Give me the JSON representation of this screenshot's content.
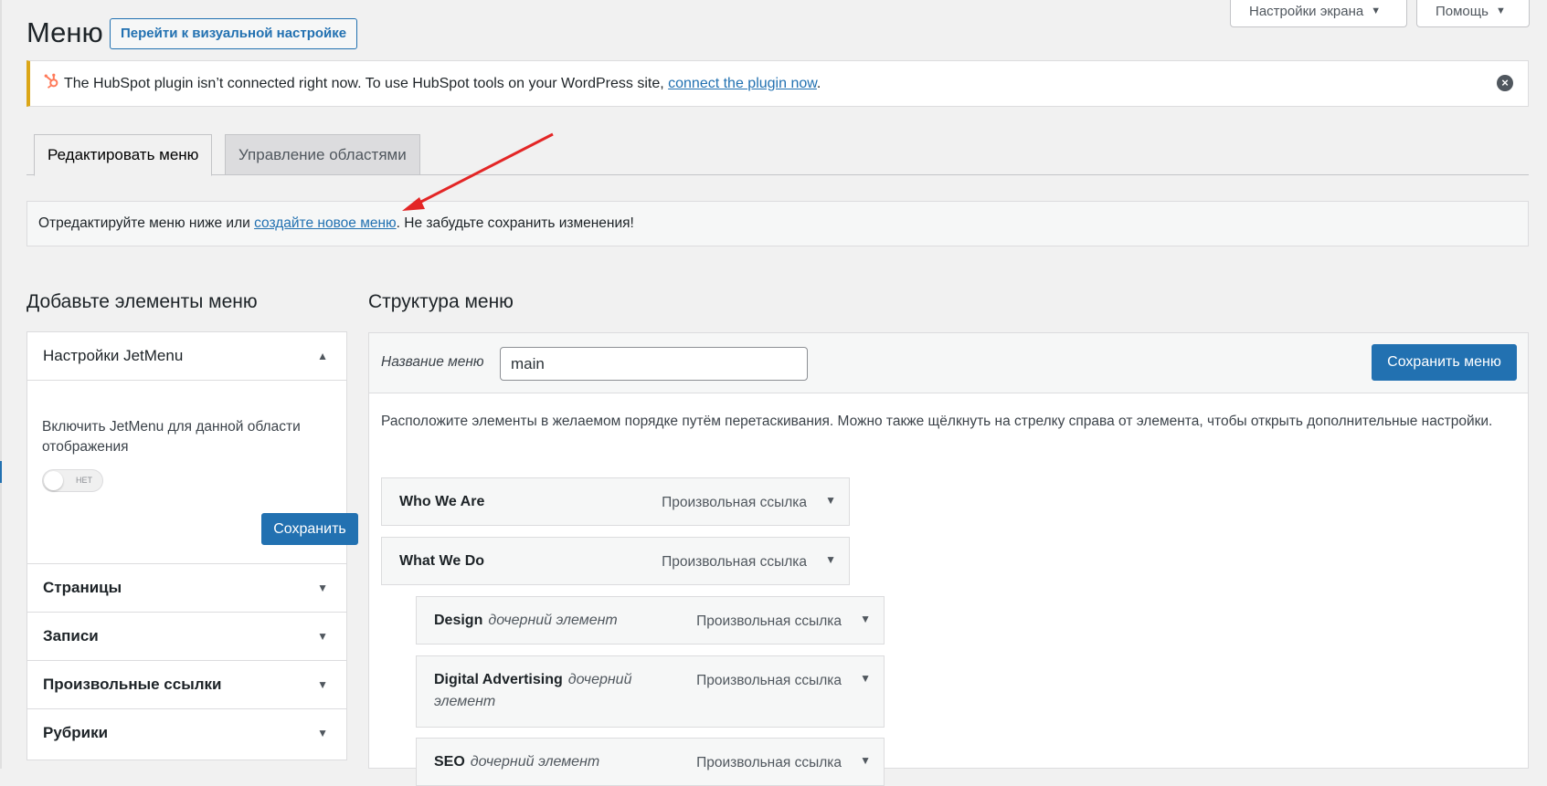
{
  "header": {
    "title": "Меню",
    "visual_settings_button": "Перейти к визуальной настройке",
    "screen_options": "Настройки экрана",
    "help": "Помощь"
  },
  "notice": {
    "text_before": "The HubSpot plugin isn’t connected right now. To use HubSpot tools on your WordPress site, ",
    "link": "connect the plugin now",
    "text_after": ".",
    "accent_color": "#dba617"
  },
  "tabs": [
    {
      "label": "Редактировать меню",
      "active": true
    },
    {
      "label": "Управление областями",
      "active": false
    }
  ],
  "manage": {
    "text_before": "Отредактируйте меню ниже или ",
    "link": "создайте новое меню",
    "text_after": ". Не забудьте сохранить изменения!"
  },
  "add_items": {
    "heading": "Добавьте элементы меню",
    "jetmenu": {
      "title": "Настройки JetMenu",
      "description": "Включить JetMenu для данной области отображения",
      "toggle_label": "НЕТ",
      "toggle_on": false,
      "save_label": "Сохранить"
    },
    "sections": [
      "Страницы",
      "Записи",
      "Произвольные ссылки",
      "Рубрики"
    ]
  },
  "structure": {
    "heading": "Структура меню",
    "menu_name_label": "Название меню",
    "menu_name_value": "main",
    "save_label": "Сохранить меню",
    "description": "Расположите элементы в желаемом порядке путём перетаскивания. Можно также щёлкнуть на стрелку справа от элемента, чтобы открыть дополнительные настройки.",
    "items": [
      {
        "title": "Who We Are",
        "sub": "",
        "type": "Произвольная ссылка"
      },
      {
        "title": "What We Do",
        "sub": "",
        "type": "Произвольная ссылка"
      },
      {
        "title": "Design",
        "sub": "дочерний элемент",
        "type": "Произвольная ссылка"
      },
      {
        "title": "Digital Advertising",
        "sub": "дочерний элемент",
        "type": "Произвольная ссылка"
      },
      {
        "title": "SEO",
        "sub": "дочерний элемент",
        "type": "Произвольная ссылка"
      }
    ]
  },
  "colors": {
    "primary": "#2271b1",
    "annotation_arrow": "#e32626"
  }
}
